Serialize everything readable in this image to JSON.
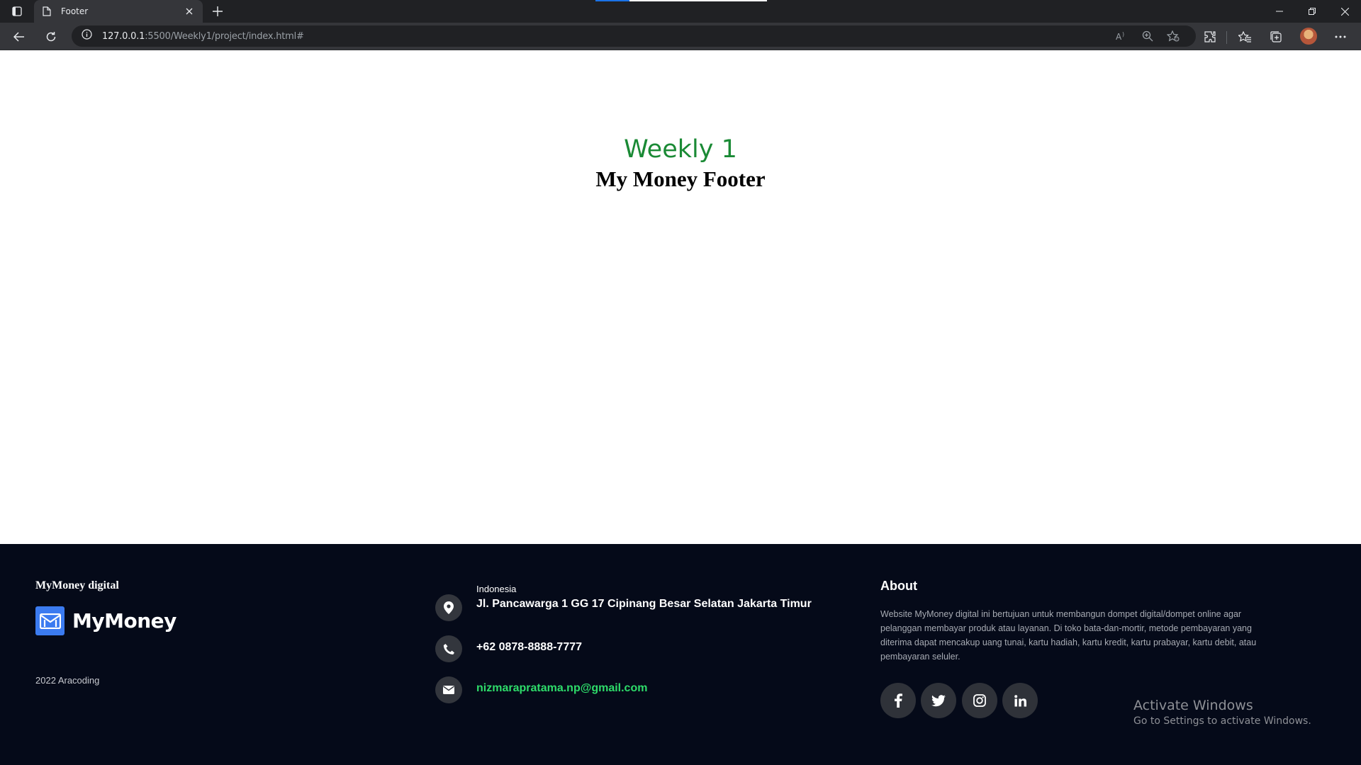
{
  "browser": {
    "tab_title": "Footer",
    "url_host": "127.0.0.1",
    "url_rest": ":5500/Weekly1/project/index.html#"
  },
  "page": {
    "subtitle": "Weekly 1",
    "title": "My Money Footer"
  },
  "footer": {
    "brand_heading": "MyMoney digital",
    "logo_text": "MyMoney",
    "copyright": "2022 Aracoding",
    "contact": {
      "country": "Indonesia",
      "address": "Jl. Pancawarga 1 GG 17 Cipinang Besar Selatan Jakarta Timur",
      "phone": "+62 0878-8888-7777",
      "email": "nizmarapratama.np@gmail.com"
    },
    "about_title": "About",
    "about_text": "Website MyMoney digital ini bertujuan untuk membangun dompet digital/dompet online agar pelanggan membayar produk atau layanan. Di toko bata-dan-mortir, metode pembayaran yang diterima dapat mencakup uang tunai, kartu hadiah, kartu kredit, kartu prabayar, kartu debit, atau pembayaran seluler.",
    "social": [
      "facebook-icon",
      "twitter-icon",
      "instagram-icon",
      "linkedin-icon"
    ]
  },
  "watermark": {
    "title": "Activate Windows",
    "subtitle": "Go to Settings to activate Windows."
  },
  "colors": {
    "footer_bg": "#050a19",
    "accent_green": "#2edc6a",
    "heading_green": "#1a8a35",
    "logo_blue": "#3b7bf0"
  }
}
